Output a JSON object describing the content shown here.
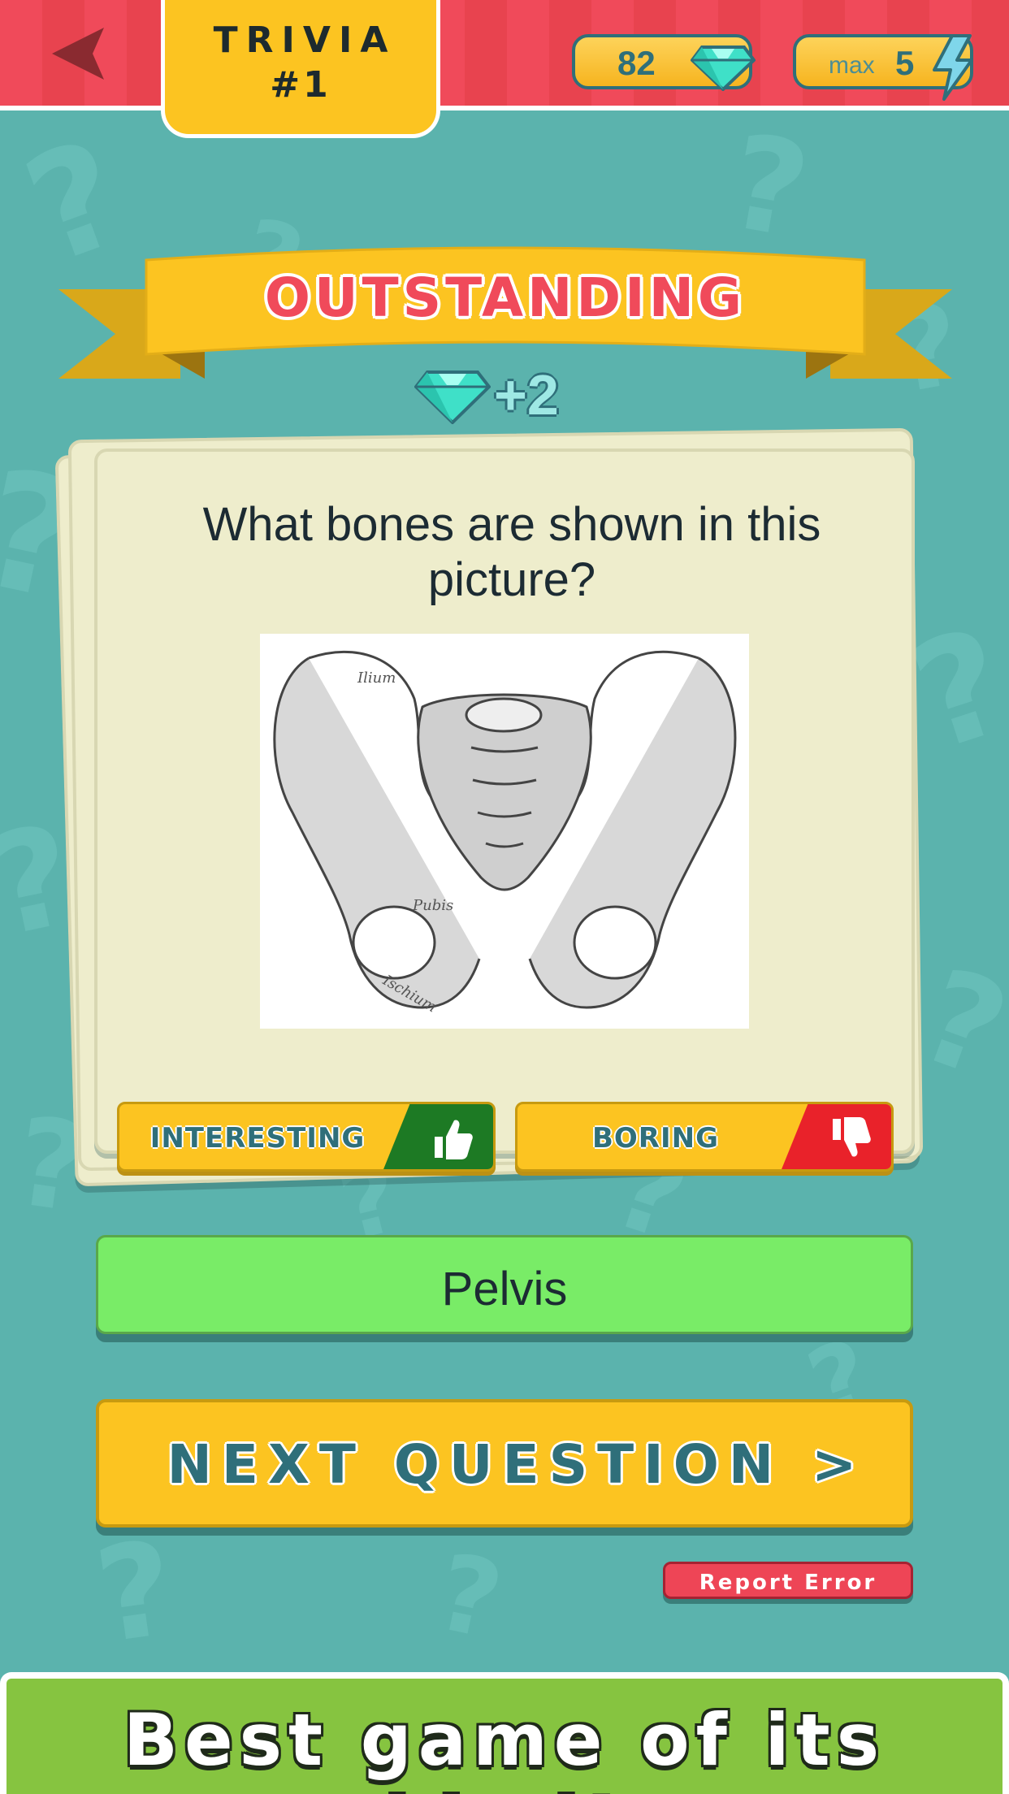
{
  "header": {
    "trivia_title": "TRIVIA",
    "trivia_number": "#1",
    "gems": "82",
    "energy_max_label": "max",
    "energy_value": "5"
  },
  "result": {
    "banner": "OUTSTANDING",
    "reward": "+2"
  },
  "card": {
    "question": "What bones are shown in this picture?",
    "image_labels": [
      "Ilium",
      "Pubis",
      "Ischium"
    ],
    "interesting_label": "INTERESTING",
    "boring_label": "BORING"
  },
  "answer": "Pelvis",
  "next_label": "NEXT QUESTION >",
  "report_label": "Report Error",
  "promo": "Best game of its kind!",
  "colors": {
    "topbar": "#f04a5a",
    "background": "#5bb3ad",
    "accent_yellow": "#fcc421",
    "answer_green": "#79ec67",
    "teal_text": "#2f6f7a",
    "promo_green": "#86c440"
  },
  "icons": [
    "back-arrow-icon",
    "diamond-icon",
    "lightning-icon",
    "thumbs-up-icon",
    "thumbs-down-icon"
  ]
}
